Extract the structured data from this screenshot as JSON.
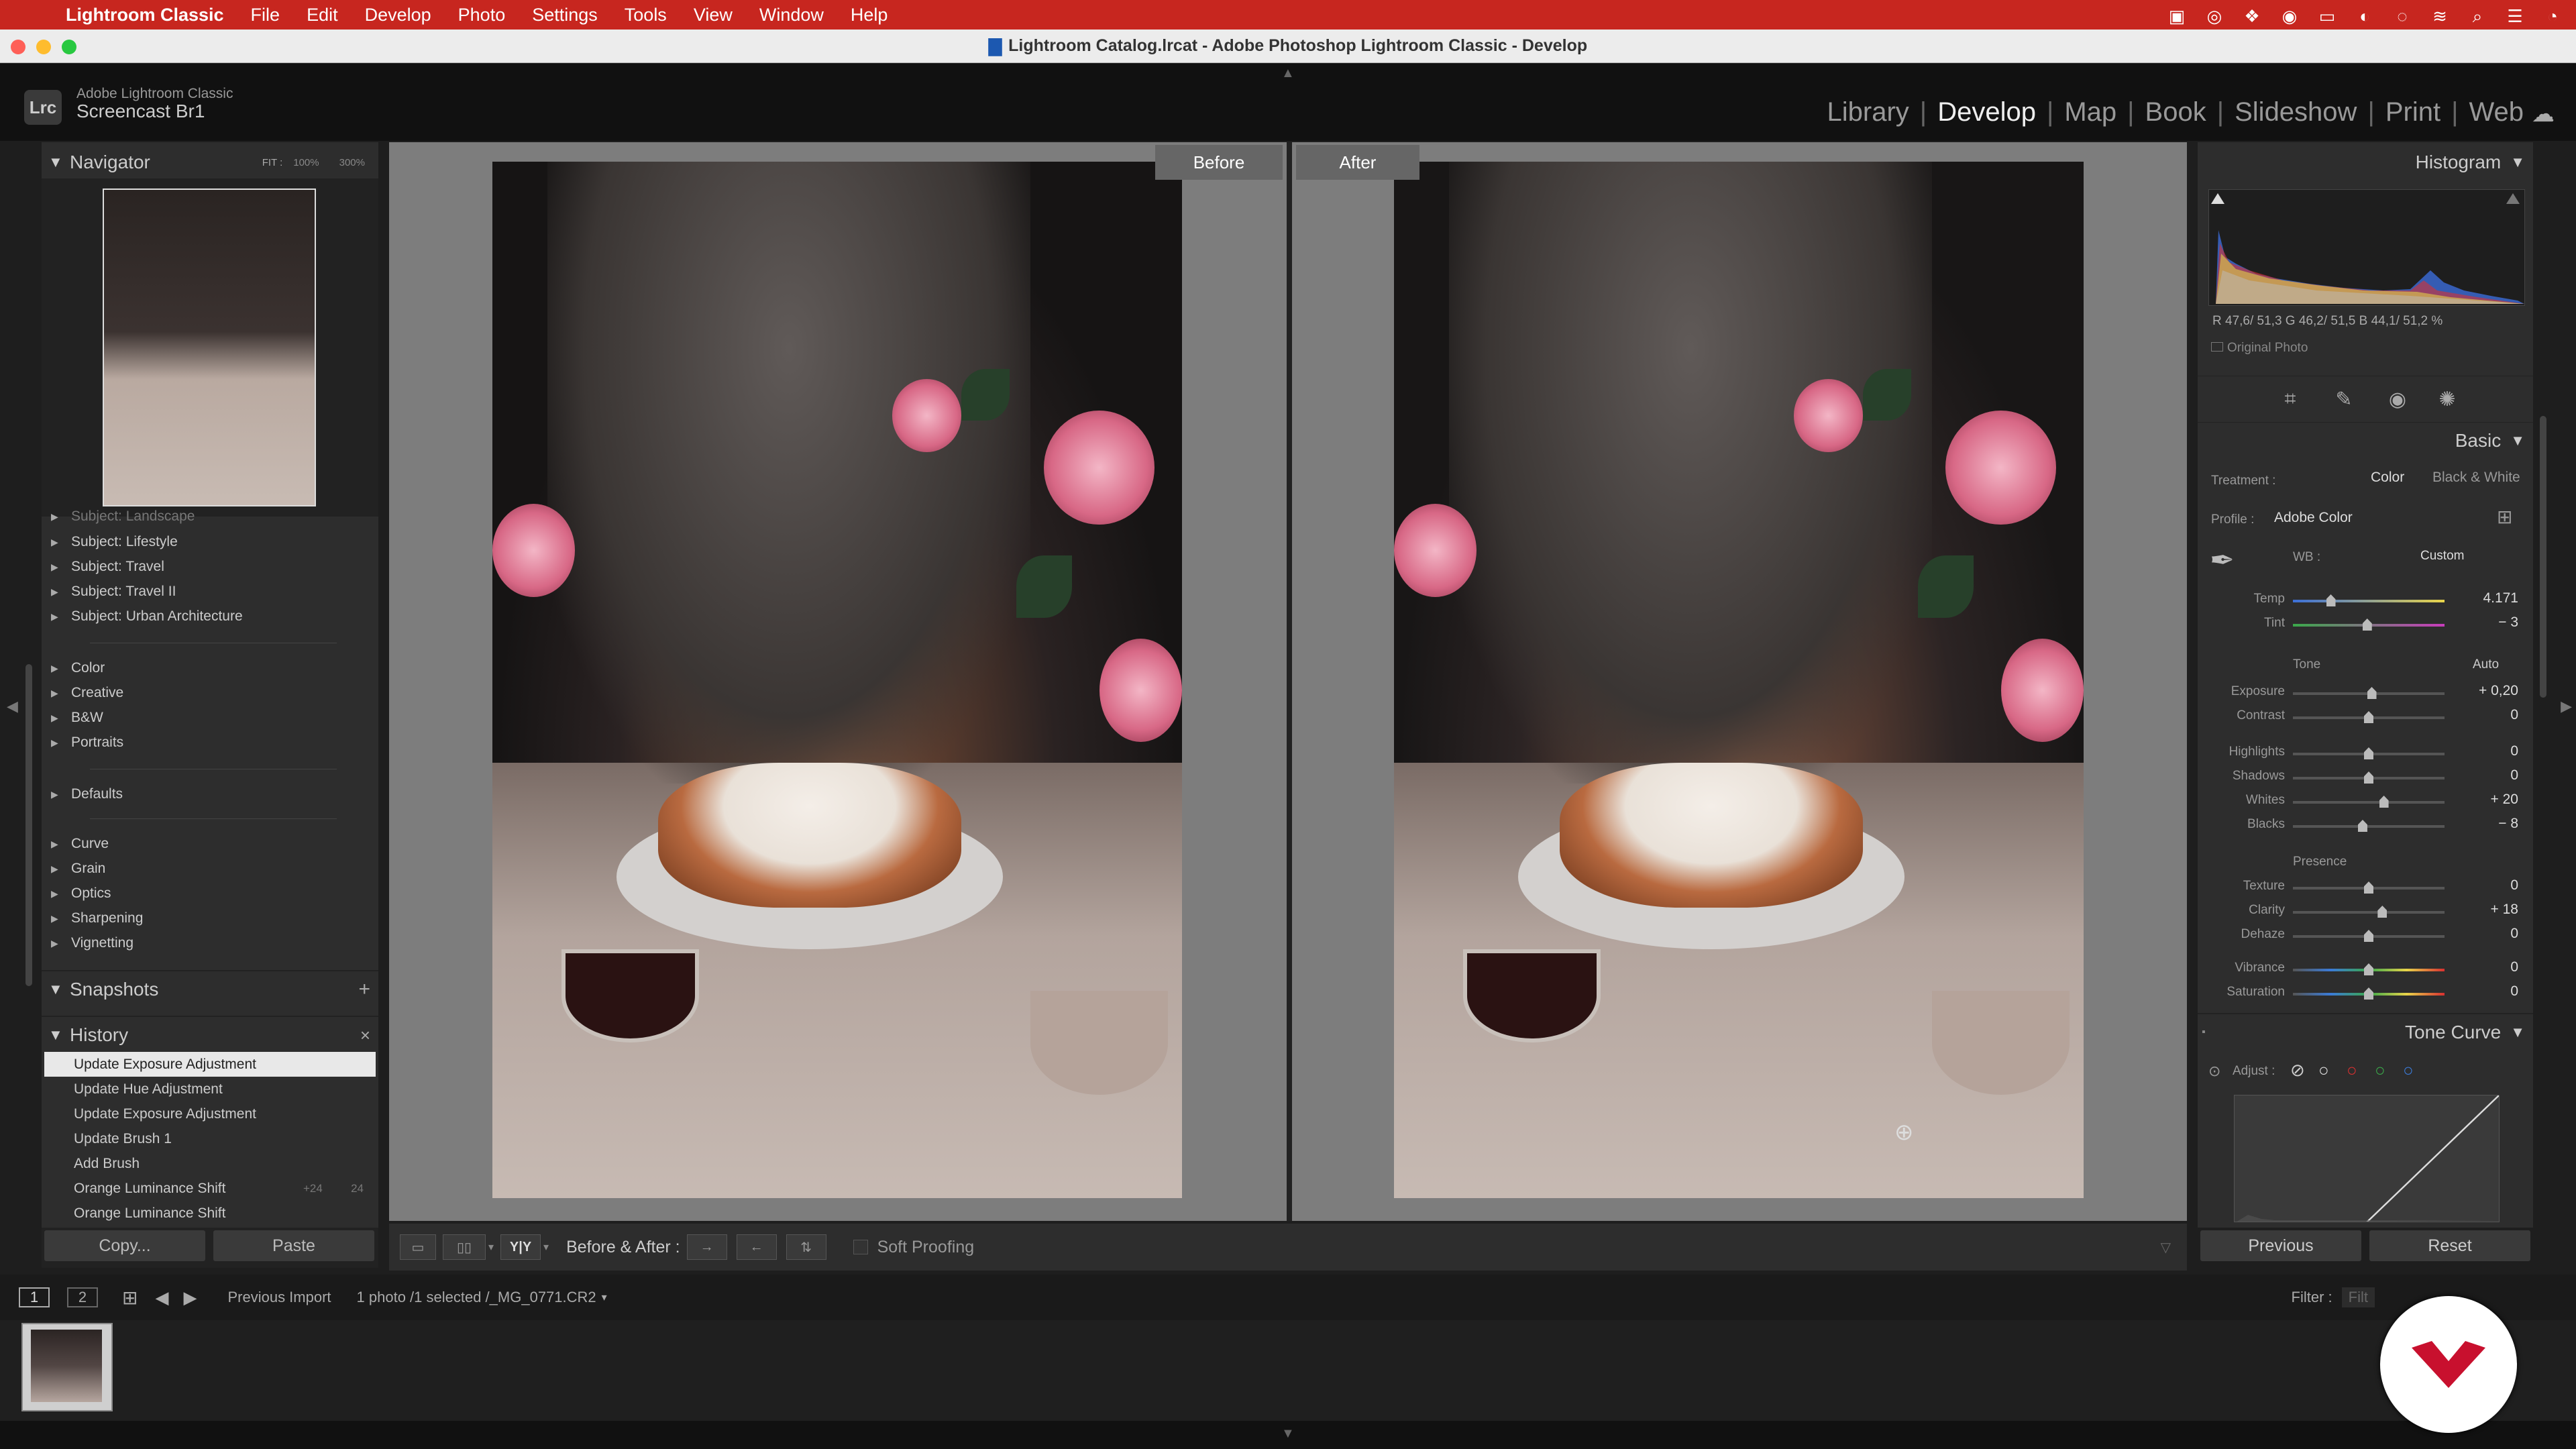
{
  "menubar": {
    "app": "Lightroom Classic",
    "items": [
      "File",
      "Edit",
      "Develop",
      "Photo",
      "Settings",
      "Tools",
      "View",
      "Window",
      "Help"
    ]
  },
  "window": {
    "title": "Lightroom Catalog.lrcat - Adobe Photoshop Lightroom Classic - Develop"
  },
  "identity": {
    "brand": "Adobe Lightroom Classic",
    "catalog": "Screencast Br1",
    "logo": "Lrc"
  },
  "modules": [
    {
      "label": "Library",
      "active": false
    },
    {
      "label": "Develop",
      "active": true
    },
    {
      "label": "Map",
      "active": false
    },
    {
      "label": "Book",
      "active": false
    },
    {
      "label": "Slideshow",
      "active": false
    },
    {
      "label": "Print",
      "active": false
    },
    {
      "label": "Web",
      "active": false
    }
  ],
  "navigator": {
    "title": "Navigator",
    "zoom_fit": "FIT :",
    "zoom_100": "100%",
    "zoom_300": "300%"
  },
  "presets": {
    "cut_top": "Subject: Landscape",
    "groups1": [
      "Subject: Lifestyle",
      "Subject: Travel",
      "Subject: Travel II",
      "Subject: Urban Architecture"
    ],
    "groups2": [
      "Color",
      "Creative",
      "B&W",
      "Portraits"
    ],
    "groups3": [
      "Defaults"
    ],
    "groups4": [
      "Curve",
      "Grain",
      "Optics",
      "Sharpening",
      "Vignetting"
    ]
  },
  "snapshots": {
    "title": "Snapshots",
    "add": "+"
  },
  "history": {
    "title": "History",
    "close": "×",
    "items": [
      {
        "label": "Update Exposure Adjustment",
        "a": "",
        "b": ""
      },
      {
        "label": "Update Hue Adjustment",
        "a": "",
        "b": ""
      },
      {
        "label": "Update Exposure Adjustment",
        "a": "",
        "b": ""
      },
      {
        "label": "Update Brush 1",
        "a": "",
        "b": ""
      },
      {
        "label": "Add Brush",
        "a": "",
        "b": ""
      },
      {
        "label": "Orange Luminance Shift",
        "a": "+24",
        "b": "24"
      },
      {
        "label": "Orange Luminance Shift",
        "a": "",
        "b": ""
      }
    ]
  },
  "left_buttons": {
    "copy": "Copy...",
    "paste": "Paste"
  },
  "compare": {
    "before": "Before",
    "after": "After"
  },
  "toolbar": {
    "ba_label": "Before & After :",
    "soft_proofing": "Soft Proofing",
    "yy": "Y|Y"
  },
  "histogram": {
    "title": "Histogram",
    "values": "R  47,6/  51,3  G  46,2/  51,5  B  44,1/  51,2 %",
    "original": "Original Photo"
  },
  "basic": {
    "title": "Basic",
    "treatment_label": "Treatment :",
    "treatment_color": "Color",
    "treatment_bw": "Black & White",
    "profile_label": "Profile :",
    "profile_value": "Adobe Color",
    "wb_label": "WB :",
    "wb_value": "Custom",
    "tone_label": "Tone",
    "tone_auto": "Auto",
    "presence_label": "Presence",
    "sliders": [
      {
        "label": "Temp",
        "value": "4.171",
        "pos": 0.25
      },
      {
        "label": "Tint",
        "value": "− 3",
        "pos": 0.49
      },
      {
        "label": "Exposure",
        "value": "+ 0,20",
        "pos": 0.52
      },
      {
        "label": "Contrast",
        "value": "0",
        "pos": 0.5
      },
      {
        "label": "Highlights",
        "value": "0",
        "pos": 0.5
      },
      {
        "label": "Shadows",
        "value": "0",
        "pos": 0.5
      },
      {
        "label": "Whites",
        "value": "+ 20",
        "pos": 0.6
      },
      {
        "label": "Blacks",
        "value": "− 8",
        "pos": 0.46
      },
      {
        "label": "Texture",
        "value": "0",
        "pos": 0.5
      },
      {
        "label": "Clarity",
        "value": "+ 18",
        "pos": 0.59
      },
      {
        "label": "Dehaze",
        "value": "0",
        "pos": 0.5
      },
      {
        "label": "Vibrance",
        "value": "0",
        "pos": 0.5
      },
      {
        "label": "Saturation",
        "value": "0",
        "pos": 0.5
      }
    ]
  },
  "tone_curve": {
    "title": "Tone Curve",
    "adjust": "Adjust :"
  },
  "right_buttons": {
    "previous": "Previous",
    "reset": "Reset"
  },
  "filmbar": {
    "page1": "1",
    "page2": "2",
    "source": "Previous Import",
    "info": "1 photo /1 selected /_MG_0771.CR2",
    "filter": "Filter :",
    "filter_value": "Filt"
  },
  "colors": {
    "menubar": "#c7261f",
    "panel": "#2d2d2d",
    "badge": "#c8102e"
  }
}
